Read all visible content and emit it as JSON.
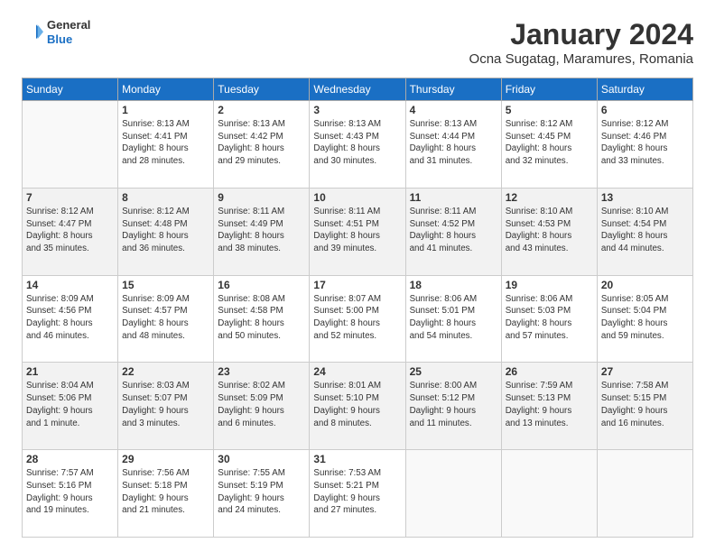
{
  "header": {
    "logo": {
      "general": "General",
      "blue": "Blue"
    },
    "title": "January 2024",
    "location": "Ocna Sugatag, Maramures, Romania"
  },
  "weekdays": [
    "Sunday",
    "Monday",
    "Tuesday",
    "Wednesday",
    "Thursday",
    "Friday",
    "Saturday"
  ],
  "weeks": [
    [
      {
        "day": "",
        "info": ""
      },
      {
        "day": "1",
        "info": "Sunrise: 8:13 AM\nSunset: 4:41 PM\nDaylight: 8 hours\nand 28 minutes."
      },
      {
        "day": "2",
        "info": "Sunrise: 8:13 AM\nSunset: 4:42 PM\nDaylight: 8 hours\nand 29 minutes."
      },
      {
        "day": "3",
        "info": "Sunrise: 8:13 AM\nSunset: 4:43 PM\nDaylight: 8 hours\nand 30 minutes."
      },
      {
        "day": "4",
        "info": "Sunrise: 8:13 AM\nSunset: 4:44 PM\nDaylight: 8 hours\nand 31 minutes."
      },
      {
        "day": "5",
        "info": "Sunrise: 8:12 AM\nSunset: 4:45 PM\nDaylight: 8 hours\nand 32 minutes."
      },
      {
        "day": "6",
        "info": "Sunrise: 8:12 AM\nSunset: 4:46 PM\nDaylight: 8 hours\nand 33 minutes."
      }
    ],
    [
      {
        "day": "7",
        "info": "Sunrise: 8:12 AM\nSunset: 4:47 PM\nDaylight: 8 hours\nand 35 minutes."
      },
      {
        "day": "8",
        "info": "Sunrise: 8:12 AM\nSunset: 4:48 PM\nDaylight: 8 hours\nand 36 minutes."
      },
      {
        "day": "9",
        "info": "Sunrise: 8:11 AM\nSunset: 4:49 PM\nDaylight: 8 hours\nand 38 minutes."
      },
      {
        "day": "10",
        "info": "Sunrise: 8:11 AM\nSunset: 4:51 PM\nDaylight: 8 hours\nand 39 minutes."
      },
      {
        "day": "11",
        "info": "Sunrise: 8:11 AM\nSunset: 4:52 PM\nDaylight: 8 hours\nand 41 minutes."
      },
      {
        "day": "12",
        "info": "Sunrise: 8:10 AM\nSunset: 4:53 PM\nDaylight: 8 hours\nand 43 minutes."
      },
      {
        "day": "13",
        "info": "Sunrise: 8:10 AM\nSunset: 4:54 PM\nDaylight: 8 hours\nand 44 minutes."
      }
    ],
    [
      {
        "day": "14",
        "info": "Sunrise: 8:09 AM\nSunset: 4:56 PM\nDaylight: 8 hours\nand 46 minutes."
      },
      {
        "day": "15",
        "info": "Sunrise: 8:09 AM\nSunset: 4:57 PM\nDaylight: 8 hours\nand 48 minutes."
      },
      {
        "day": "16",
        "info": "Sunrise: 8:08 AM\nSunset: 4:58 PM\nDaylight: 8 hours\nand 50 minutes."
      },
      {
        "day": "17",
        "info": "Sunrise: 8:07 AM\nSunset: 5:00 PM\nDaylight: 8 hours\nand 52 minutes."
      },
      {
        "day": "18",
        "info": "Sunrise: 8:06 AM\nSunset: 5:01 PM\nDaylight: 8 hours\nand 54 minutes."
      },
      {
        "day": "19",
        "info": "Sunrise: 8:06 AM\nSunset: 5:03 PM\nDaylight: 8 hours\nand 57 minutes."
      },
      {
        "day": "20",
        "info": "Sunrise: 8:05 AM\nSunset: 5:04 PM\nDaylight: 8 hours\nand 59 minutes."
      }
    ],
    [
      {
        "day": "21",
        "info": "Sunrise: 8:04 AM\nSunset: 5:06 PM\nDaylight: 9 hours\nand 1 minute."
      },
      {
        "day": "22",
        "info": "Sunrise: 8:03 AM\nSunset: 5:07 PM\nDaylight: 9 hours\nand 3 minutes."
      },
      {
        "day": "23",
        "info": "Sunrise: 8:02 AM\nSunset: 5:09 PM\nDaylight: 9 hours\nand 6 minutes."
      },
      {
        "day": "24",
        "info": "Sunrise: 8:01 AM\nSunset: 5:10 PM\nDaylight: 9 hours\nand 8 minutes."
      },
      {
        "day": "25",
        "info": "Sunrise: 8:00 AM\nSunset: 5:12 PM\nDaylight: 9 hours\nand 11 minutes."
      },
      {
        "day": "26",
        "info": "Sunrise: 7:59 AM\nSunset: 5:13 PM\nDaylight: 9 hours\nand 13 minutes."
      },
      {
        "day": "27",
        "info": "Sunrise: 7:58 AM\nSunset: 5:15 PM\nDaylight: 9 hours\nand 16 minutes."
      }
    ],
    [
      {
        "day": "28",
        "info": "Sunrise: 7:57 AM\nSunset: 5:16 PM\nDaylight: 9 hours\nand 19 minutes."
      },
      {
        "day": "29",
        "info": "Sunrise: 7:56 AM\nSunset: 5:18 PM\nDaylight: 9 hours\nand 21 minutes."
      },
      {
        "day": "30",
        "info": "Sunrise: 7:55 AM\nSunset: 5:19 PM\nDaylight: 9 hours\nand 24 minutes."
      },
      {
        "day": "31",
        "info": "Sunrise: 7:53 AM\nSunset: 5:21 PM\nDaylight: 9 hours\nand 27 minutes."
      },
      {
        "day": "",
        "info": ""
      },
      {
        "day": "",
        "info": ""
      },
      {
        "day": "",
        "info": ""
      }
    ]
  ]
}
